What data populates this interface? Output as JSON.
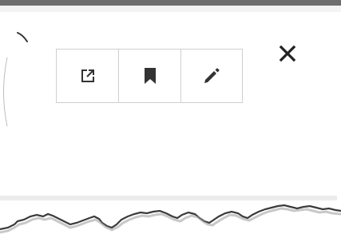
{
  "window": {
    "top_bar_color": "#6e6e6e"
  },
  "toolbar": {
    "buttons": [
      {
        "icon": "open-external-icon"
      },
      {
        "icon": "bookmark-icon"
      },
      {
        "icon": "pencil-icon"
      }
    ],
    "border_color": "#cfcfcf",
    "icon_color": "#333333"
  },
  "close_button": {
    "icon": "close-icon"
  }
}
